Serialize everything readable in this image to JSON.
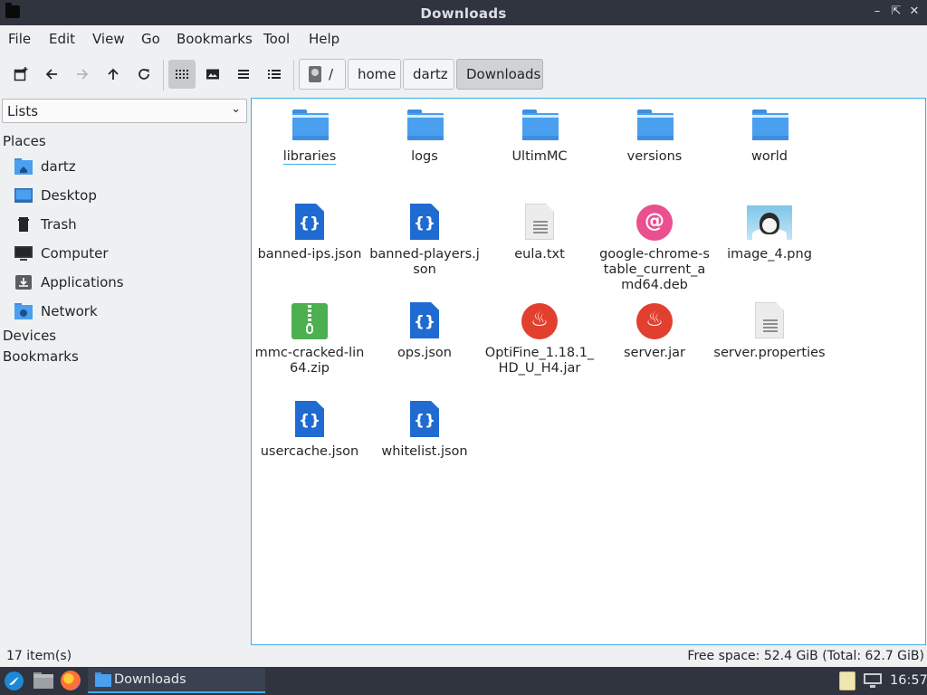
{
  "window": {
    "title": "Downloads"
  },
  "menubar": {
    "items": [
      "File",
      "Edit",
      "View",
      "Go",
      "Bookmarks",
      "Tool",
      "Help"
    ]
  },
  "toolbar": {
    "buttons": [
      "new-tab",
      "back",
      "forward",
      "up",
      "reload",
      "icon-view",
      "thumbnail-view",
      "compact-view",
      "detailed-list-view"
    ],
    "breadcrumbs": [
      "/",
      "home",
      "dartz",
      "Downloads"
    ]
  },
  "sidebar": {
    "mode": "Lists",
    "sections": [
      "Places",
      "Devices",
      "Bookmarks"
    ],
    "places": [
      {
        "label": "dartz",
        "icon": "home-folder-icon"
      },
      {
        "label": "Desktop",
        "icon": "desktop-icon"
      },
      {
        "label": "Trash",
        "icon": "trash-icon"
      },
      {
        "label": "Computer",
        "icon": "computer-icon"
      },
      {
        "label": "Applications",
        "icon": "applications-icon"
      },
      {
        "label": "Network",
        "icon": "network-icon"
      }
    ]
  },
  "files": [
    {
      "name": "libraries",
      "type": "folder"
    },
    {
      "name": "logs",
      "type": "folder"
    },
    {
      "name": "UltimMC",
      "type": "folder"
    },
    {
      "name": "versions",
      "type": "folder"
    },
    {
      "name": "world",
      "type": "folder"
    },
    {
      "name": "banned-ips.json",
      "type": "json"
    },
    {
      "name": "banned-players.json",
      "type": "json"
    },
    {
      "name": "eula.txt",
      "type": "text"
    },
    {
      "name": "google-chrome-stable_current_amd64.deb",
      "type": "deb"
    },
    {
      "name": "image_4.png",
      "type": "image"
    },
    {
      "name": "mmc-cracked-lin64.zip",
      "type": "zip"
    },
    {
      "name": "ops.json",
      "type": "json"
    },
    {
      "name": "OptiFine_1.18.1_HD_U_H4.jar",
      "type": "jar"
    },
    {
      "name": "server.jar",
      "type": "jar"
    },
    {
      "name": "server.properties",
      "type": "text"
    },
    {
      "name": "usercache.json",
      "type": "json"
    },
    {
      "name": "whitelist.json",
      "type": "json"
    }
  ],
  "status": {
    "count": "17 item(s)",
    "free_space": "Free space: 52.4 GiB (Total: 62.7 GiB)"
  },
  "taskbar": {
    "window_label": "Downloads",
    "clock": "16:57"
  },
  "colors": {
    "accent": "#3daee9",
    "folder": "#4a9fef",
    "json": "#1f6bd1",
    "titlebar": "#2f343f"
  }
}
